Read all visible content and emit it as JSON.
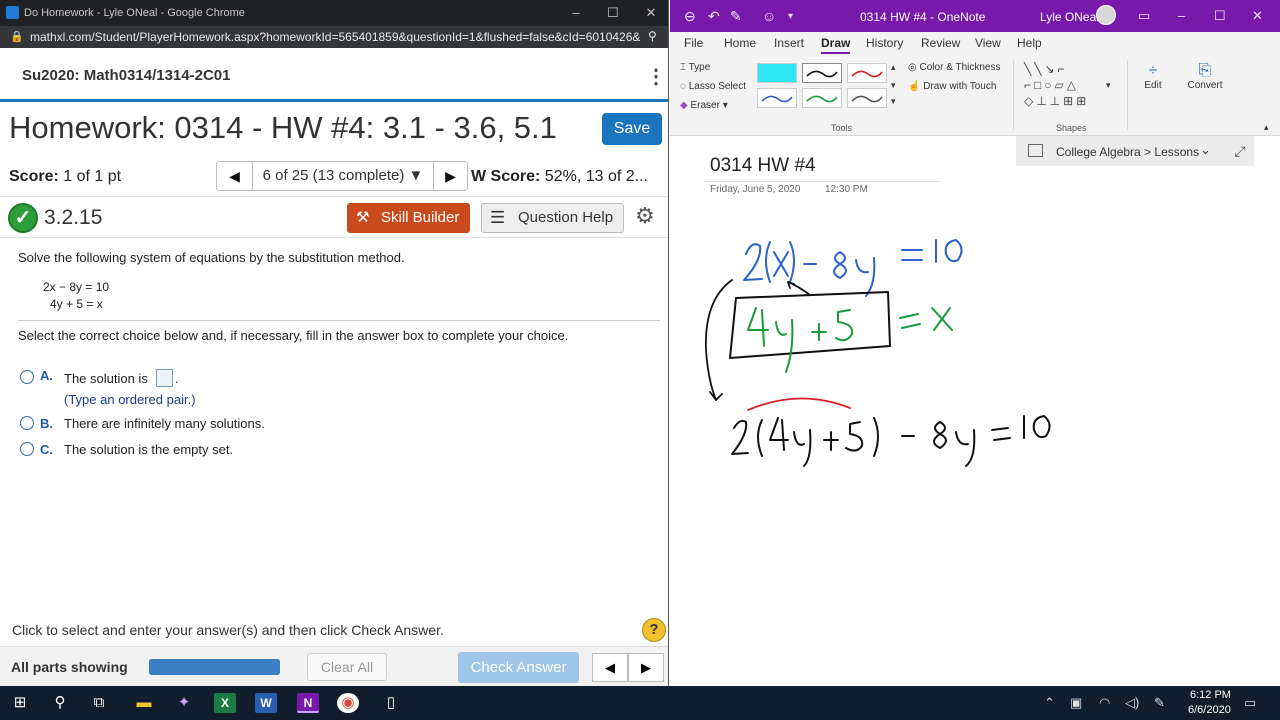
{
  "chrome": {
    "window_title": "Do Homework - Lyle ONeal - Google Chrome",
    "url": "mathxl.com/Student/PlayerHomework.aspx?homeworkId=565401859&questionId=1&flushed=false&cId=6010426&...",
    "min": "–",
    "max": "☐",
    "close": "✕"
  },
  "course": {
    "name": "Su2020: Math0314/1314-2C01"
  },
  "homework": {
    "title": "Homework: 0314 - HW #4: 3.1 - 3.6, 5.1",
    "save_label": "Save",
    "score_label": "Score:",
    "score_value": "1 of 1 pt",
    "nav_label": "6 of 25 (13 complete) ▼",
    "hw_score_label": "W Score:",
    "hw_score_value": "52%, 13 of 2..."
  },
  "question": {
    "number": "3.2.15",
    "skill_builder_label": "Skill Builder",
    "question_help_label": "Question Help",
    "prompt": "Solve the following system of equations by the substitution method.",
    "eq1": "2x − 8y = 10",
    "eq2": "4y + 5 = x",
    "instruction": "Select the correct choice below and, if necessary, fill in the answer box to complete your choice.",
    "options": [
      {
        "letter": "A.",
        "text": "The solution is",
        "suffix": ".",
        "hint": "(Type an ordered pair.)"
      },
      {
        "letter": "B.",
        "text": "There are infinitely many solutions."
      },
      {
        "letter": "C.",
        "text": "The solution is the empty set."
      }
    ]
  },
  "footer": {
    "hint": "Click to select and enter your answer(s) and then click Check Answer.",
    "all_parts": "All parts showing",
    "progress": 1.0,
    "clear_all": "Clear All",
    "check_answer": "Check Answer"
  },
  "onenote": {
    "doc_title": "0314 HW #4  -  OneNote",
    "user": "Lyle ONeal",
    "tabs": [
      "File",
      "Home",
      "Insert",
      "Draw",
      "History",
      "Review",
      "View",
      "Help"
    ],
    "tools": {
      "type": "Type",
      "lasso": "Lasso Select",
      "eraser": "Eraser",
      "color": "Color & Thickness",
      "touch": "Draw with Touch",
      "tools_label": "Tools",
      "shapes_label": "Shapes",
      "edit": "Edit",
      "convert": "Convert"
    },
    "breadcrumb": "College Algebra > Lessons",
    "page_title": "0314 HW #4",
    "page_date": "Friday, June 5, 2020",
    "page_time": "12:30 PM"
  },
  "taskbar": {
    "time": "6:12 PM",
    "date": "6/6/2020"
  }
}
